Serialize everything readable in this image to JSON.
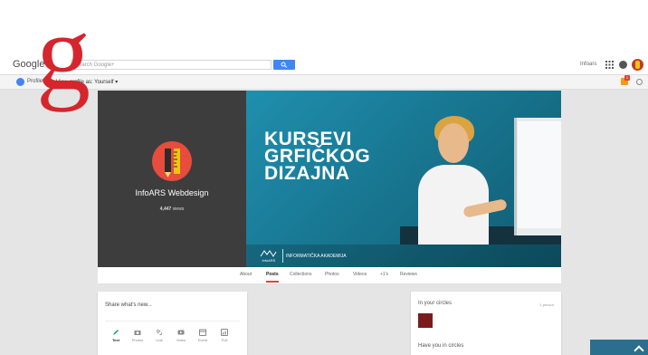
{
  "logo": {
    "letter": "g"
  },
  "topbar": {
    "brand_google": "Google",
    "brand_plus": "+",
    "search_placeholder": "Search Google+",
    "user_name": "Infoars"
  },
  "subbar": {
    "profile_label": "Profile",
    "view_label": "View profile as: Yourself",
    "notification_count": "1"
  },
  "profile": {
    "name": "InfoARS Webdesign",
    "views_count": "4,447",
    "views_label": "views"
  },
  "cover": {
    "title_lines": [
      "KURSEVI",
      "GRFIČKOG",
      "DIZAJNA"
    ],
    "brand_mark": "infoARS",
    "academy": "INFORMATIČKA AKADEMIJA"
  },
  "tabs": [
    {
      "label": "About"
    },
    {
      "label": "Posts",
      "active": true
    },
    {
      "label": "Collections"
    },
    {
      "label": "Photos"
    },
    {
      "label": "Videos"
    },
    {
      "label": "+1's"
    },
    {
      "label": "Reviews"
    }
  ],
  "share": {
    "prompt": "Share what's new...",
    "tools": [
      {
        "label": "Text",
        "icon": "pencil-icon",
        "active": true
      },
      {
        "label": "Photos",
        "icon": "camera-icon"
      },
      {
        "label": "Link",
        "icon": "link-icon"
      },
      {
        "label": "Video",
        "icon": "video-icon"
      },
      {
        "label": "Event",
        "icon": "calendar-icon"
      },
      {
        "label": "Poll",
        "icon": "poll-icon"
      }
    ]
  },
  "circles": {
    "title": "In your circles",
    "count": "1 person",
    "have_you_title": "Have you in circles"
  },
  "colors": {
    "google_red": "#db4437",
    "google_blue": "#4285f4",
    "cover_teal": "#1b7f9c",
    "profile_dark": "#3d3d3d"
  }
}
